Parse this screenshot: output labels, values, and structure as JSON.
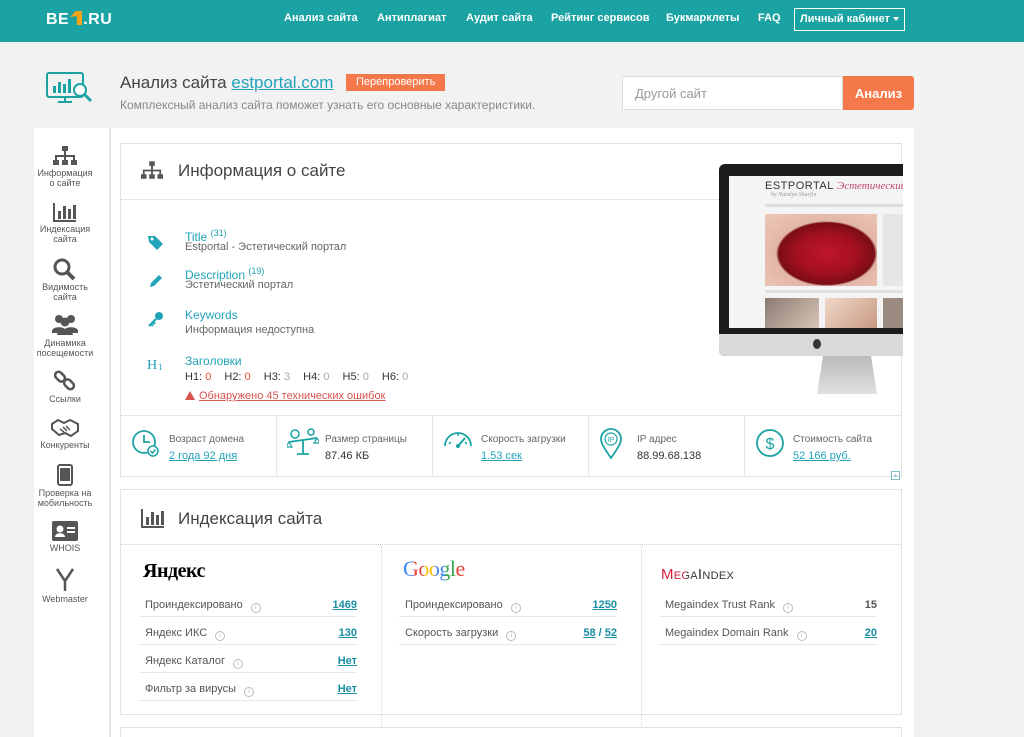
{
  "header": {
    "logo": {
      "left": "BE",
      "right": ".RU"
    },
    "nav": [
      {
        "label": "Анализ сайта"
      },
      {
        "label": "Антиплагиат"
      },
      {
        "label": "Аудит сайта"
      },
      {
        "label": "Рейтинг сервисов"
      },
      {
        "label": "Букмарклеты"
      },
      {
        "label": "FAQ"
      }
    ],
    "cabinet": "Личный кабинет"
  },
  "site_header": {
    "title_prefix": "Анализ сайта",
    "domain": "estportal.com",
    "recheck": "Перепроверить",
    "subtitle": "Комплексный анализ сайта поможет узнать его основные характеристики.",
    "search_placeholder": "Другой сайт",
    "analyze_button": "Анализ"
  },
  "sidebar": [
    {
      "label1": "Информация",
      "label2": "о сайте",
      "icon": "sitemap-icon"
    },
    {
      "label1": "Индексация",
      "label2": "сайта",
      "icon": "bar-chart-icon"
    },
    {
      "label1": "Видимость",
      "label2": "сайта",
      "icon": "search-icon"
    },
    {
      "label1": "Динамика",
      "label2": "посещемости",
      "icon": "users-icon"
    },
    {
      "label1": "Ссылки",
      "label2": "",
      "icon": "link-icon"
    },
    {
      "label1": "Конкуренты",
      "label2": "",
      "icon": "handshake-icon"
    },
    {
      "label1": "Проверка на",
      "label2": "мобильность",
      "icon": "mobile-icon"
    },
    {
      "label1": "WHOIS",
      "label2": "",
      "icon": "id-card-icon"
    },
    {
      "label1": "Webmaster",
      "label2": "",
      "icon": "yandex-y-icon"
    }
  ],
  "info": {
    "title": "Информация о сайте",
    "title_tag": {
      "label": "Title",
      "count": "(31)",
      "value": "Estportal - Эстетический портал"
    },
    "description": {
      "label": "Description",
      "count": "(19)",
      "value": "Эстетический портал"
    },
    "keywords": {
      "label": "Keywords",
      "value": "Информация недоступна"
    },
    "headings": {
      "label": "Заголовки",
      "items": [
        {
          "tag": "H1:",
          "val": "0"
        },
        {
          "tag": "H2:",
          "val": "0"
        },
        {
          "tag": "H3:",
          "val": "3"
        },
        {
          "tag": "H4:",
          "val": "0"
        },
        {
          "tag": "H5:",
          "val": "0"
        },
        {
          "tag": "H6:",
          "val": "0"
        }
      ]
    },
    "errors": "Обнаружено 45 технических ошибок",
    "preview": {
      "logo": "ESTPORTAL",
      "logo_sub": "by Natalya Sharfin",
      "tagline": "Эстетический"
    }
  },
  "metrics": [
    {
      "label": "Возраст домена",
      "value": "2 года 92 дня",
      "icon": "clock-icon"
    },
    {
      "label": "Размер страницы",
      "value": "87.46 КБ",
      "icon": "scale-icon"
    },
    {
      "label": "Скорость загрузки",
      "value": "1.53 сек",
      "icon": "gauge-icon"
    },
    {
      "label": "IP адрес",
      "value": "88.99.68.138",
      "icon": "location-pin-icon"
    },
    {
      "label": "Стоимость сайта",
      "value": "52 166 руб.",
      "icon": "dollar-icon"
    }
  ],
  "indexing": {
    "title": "Индексация сайта",
    "yandex": {
      "logo": "Яндекс",
      "rows": [
        {
          "name": "Проиндексировано",
          "value": "1469"
        },
        {
          "name": "Яндекс ИКС",
          "value": "130"
        },
        {
          "name": "Яндекс Каталог",
          "value": "Нет"
        },
        {
          "name": "Фильтр за вирусы",
          "value": "Нет"
        }
      ]
    },
    "google": {
      "logo": "Google",
      "rows": [
        {
          "name": "Проиндексировано",
          "value": "1250"
        },
        {
          "name": "Скорость загрузки",
          "value_a": "58",
          "value_sep": " / ",
          "value_b": "52"
        }
      ]
    },
    "megaindex": {
      "logo": "MegaIndex",
      "rows": [
        {
          "name": "Megaindex Trust Rank",
          "value": "15"
        },
        {
          "name": "Megaindex Domain Rank",
          "value": "20"
        }
      ]
    }
  },
  "colors": {
    "teal": "#1ba3a3",
    "orange": "#f5784a",
    "link": "#21a3b8",
    "error": "#d9534f"
  }
}
